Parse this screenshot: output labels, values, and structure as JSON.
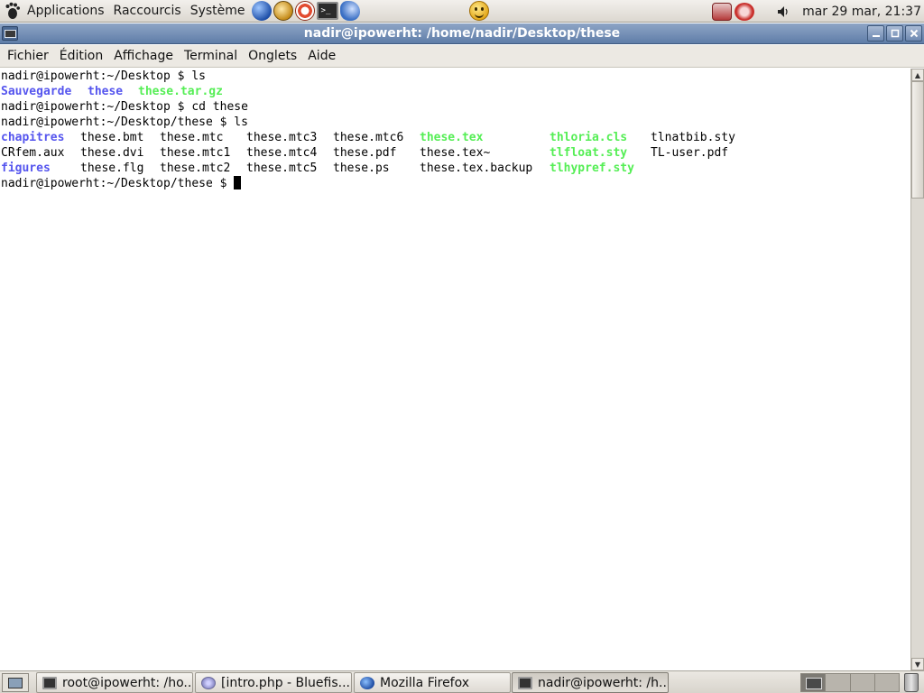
{
  "top_panel": {
    "menus": [
      "Applications",
      "Raccourcis",
      "Système"
    ],
    "launchers": [
      "web-browser-icon",
      "mail-client-icon",
      "help-icon",
      "terminal-icon",
      "gaim-icon"
    ],
    "clock": "mar 29 mar, 21:37"
  },
  "window": {
    "title": "nadir@ipowerht: /home/nadir/Desktop/these",
    "controls": [
      "minimize",
      "maximize",
      "close"
    ]
  },
  "menubar": {
    "fichier": "Fichier",
    "edition": "Édition",
    "affichage": "Affichage",
    "terminal": "Terminal",
    "onglets": "Onglets",
    "aide": "Aide"
  },
  "terminal": {
    "colors": {
      "directory": "#5555ee",
      "executable": "#55ee55",
      "text": "#000000"
    },
    "line1": "nadir@ipowerht:~/Desktop $ ls",
    "ls1": [
      "Sauvegarde",
      "these",
      "these.tar.gz"
    ],
    "line3": "nadir@ipowerht:~/Desktop $ cd these",
    "line4": "nadir@ipowerht:~/Desktop/these $ ls",
    "ls2": {
      "row1": [
        "chapitres",
        "these.bmt",
        "these.mtc",
        "these.mtc3",
        "these.mtc6",
        "these.tex",
        "thloria.cls",
        "tlnatbib.sty"
      ],
      "row2": [
        "CRfem.aux",
        "these.dvi",
        "these.mtc1",
        "these.mtc4",
        "these.pdf",
        "these.tex~",
        "tlfloat.sty",
        "TL-user.pdf"
      ],
      "row3": [
        "figures",
        "these.flg",
        "these.mtc2",
        "these.mtc5",
        "these.ps",
        "these.tex.backup",
        "tlhypref.sty"
      ]
    },
    "prompt": "nadir@ipowerht:~/Desktop/these $ "
  },
  "taskbar": {
    "tasks": [
      "root@ipowerht: /ho...",
      "[intro.php - Bluefis...",
      "Mozilla Firefox",
      "nadir@ipowerht: /h..."
    ],
    "active_task": 3
  }
}
